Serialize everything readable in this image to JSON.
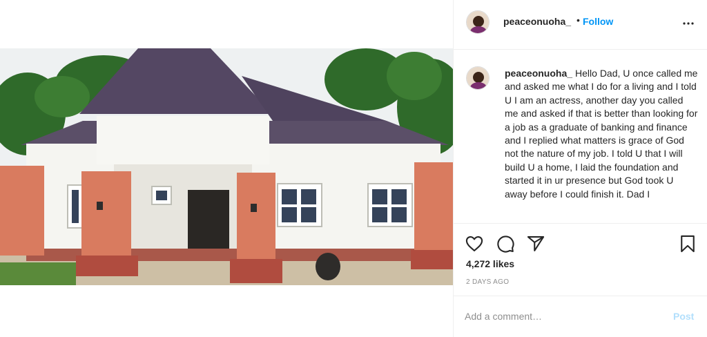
{
  "post": {
    "username": "peaceonuoha_",
    "follow_separator": "•",
    "follow_label": "Follow",
    "more_icon": "more-horizontal-icon",
    "caption_text": "Hello Dad, U once called me and asked me what I do for a living and I told U I am an actress, another day you called me and asked if that is better than looking for a job as a graduate of banking and finance and I replied what matters is grace of God not the nature of my job. I told U that I will build U a home, I laid the foundation and started it in ur presence but God took U away before I could finish it. Dad I",
    "likes": "4,272 likes",
    "date": "2 DAYS AGO"
  },
  "actions": {
    "like_icon": "heart-icon",
    "comment_icon": "comment-icon",
    "share_icon": "paper-plane-icon",
    "save_icon": "bookmark-icon"
  },
  "comment": {
    "placeholder": "Add a comment…",
    "post_label": "Post"
  },
  "colors": {
    "link_blue": "#0095f6",
    "post_disabled": "#b2dffc",
    "muted": "#8e8e8e",
    "text": "#262626"
  }
}
